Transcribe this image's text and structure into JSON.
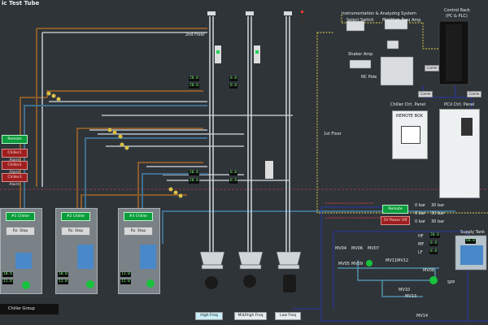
{
  "window": {
    "title": "ic Test Tube"
  },
  "floors": {
    "second": "2nd Floor",
    "first": "1st Floor"
  },
  "left_panel": {
    "remote_label": "Remote",
    "alarms": [
      "Chiller1 Alarm",
      "Chiller2 Alarm",
      "Chiller3 Alarm"
    ]
  },
  "chillers": [
    {
      "name": "#1 Chiller",
      "stop_label": "Rz. Stop",
      "values": [
        "10.0",
        "11.0"
      ],
      "unit": "°C"
    },
    {
      "name": "#2 Chiller",
      "stop_label": "Rz. Stop",
      "values": [
        "10.0",
        "11.0"
      ],
      "unit": "°C"
    },
    {
      "name": "#3 Chiller",
      "stop_label": "Rz. Stop",
      "values": [
        "11.0",
        "11.0"
      ],
      "unit": "°C"
    }
  ],
  "riser_readouts": {
    "upper": [
      "20.0",
      "0.0",
      "20.0",
      "0.0"
    ],
    "lower": [
      "20.0",
      "0.0",
      "20.0",
      "0.0"
    ]
  },
  "instrumentation": {
    "title": "Instrumentation & Analyzing System",
    "select_switch": "Select Switch",
    "amp": "Mid/High Freq Amp",
    "shaker_amp": "Shaker Amp",
    "nc_pole": "NC Pole"
  },
  "control_rack": {
    "title": "Control Rack",
    "subtitle": "(PC & PLC)"
  },
  "comm_labels": [
    "Comm",
    "Comm",
    "Comm"
  ],
  "chiller_ctrl_panel": {
    "title": "Chiller Ctrl. Panel",
    "remote_box": "REMOTE BOX"
  },
  "pcu_ctrl_panel": {
    "title": "PCU Ctrl. Panel"
  },
  "pump_controls": {
    "remote_label": "Remote",
    "power_label": "5V Power Off",
    "options": [
      "0 bar",
      "30 bar",
      "0 bar",
      "30 bar",
      "0 bar",
      "30 bar"
    ]
  },
  "supply_tank": {
    "title": "Supply Tank",
    "value": "60.0"
  },
  "gauges": [
    {
      "label": "HF",
      "value": "20.0"
    },
    {
      "label": "MF",
      "value": "0.0"
    },
    {
      "label": "LF",
      "value": "0.0"
    }
  ],
  "valves": [
    "MV04",
    "MV05",
    "MV06",
    "MV07",
    "MV08",
    "MV09",
    "MV10",
    "MV11",
    "MV12",
    "MV13",
    "MV14",
    "SV05",
    "SV06",
    "SV07",
    "SV11",
    "SV12",
    "SV13",
    "SV14",
    "SV15"
  ],
  "pump_labels": [
    "SPP"
  ],
  "bottom": {
    "group_label": "Chiller Group",
    "freq_buttons": [
      "High Freq",
      "Mid/High Freq",
      "Low Freq"
    ]
  },
  "colors": {
    "brown_pipe": "#8a5a2a",
    "blue_pipe": "#3f6f8f",
    "white_pipe": "#dfe6ea",
    "yellow_signal": "#e6d84a",
    "navy_signal": "#2636a8",
    "red_dash": "#c04040",
    "bg": "#2f3439"
  }
}
